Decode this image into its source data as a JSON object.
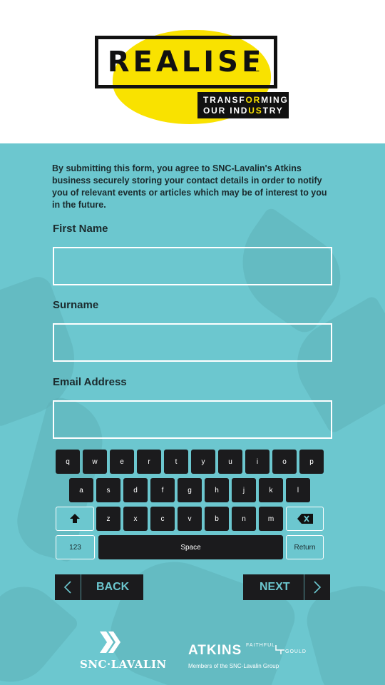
{
  "header": {
    "logo_word": "REALISE",
    "tagline_line1_a": "TRANSF",
    "tagline_line1_b": "OR",
    "tagline_line1_c": "MING",
    "tagline_line2_a": "OUR IND",
    "tagline_line2_b": "US",
    "tagline_line2_c": "TRY"
  },
  "form": {
    "consent": "By submitting this form, you agree to SNC-Lavalin's Atkins business securely storing your contact details in order to notify you of relevant events or articles which may be of interest to you in the future.",
    "first_name_label": "First Name",
    "first_name_value": "",
    "surname_label": "Surname",
    "surname_value": "",
    "email_label": "Email Address",
    "email_value": ""
  },
  "keyboard": {
    "row1": [
      "q",
      "w",
      "e",
      "r",
      "t",
      "y",
      "u",
      "i",
      "o",
      "p"
    ],
    "row2": [
      "a",
      "s",
      "d",
      "f",
      "g",
      "h",
      "j",
      "k",
      "l"
    ],
    "row3": [
      "z",
      "x",
      "c",
      "v",
      "b",
      "n",
      "m"
    ],
    "shift_icon": "shift-arrow-icon",
    "backspace_icon": "backspace-icon",
    "numbers_label": "123",
    "space_label": "Space",
    "return_label": "Return"
  },
  "nav": {
    "back_label": "BACK",
    "next_label": "NEXT"
  },
  "footer": {
    "snc_logo": "SNC·LAVALIN",
    "atkins_logo": "ATKINS",
    "fg_top": "FAITHFUL",
    "fg_bottom": "GOULD",
    "members_text": "Members of the SNC-Lavalin Group"
  },
  "colors": {
    "teal_bg": "#6cc7cf",
    "brand_yellow": "#f9e200",
    "key_dark": "#1b1b1d",
    "text_dark": "#1b2b2e"
  }
}
